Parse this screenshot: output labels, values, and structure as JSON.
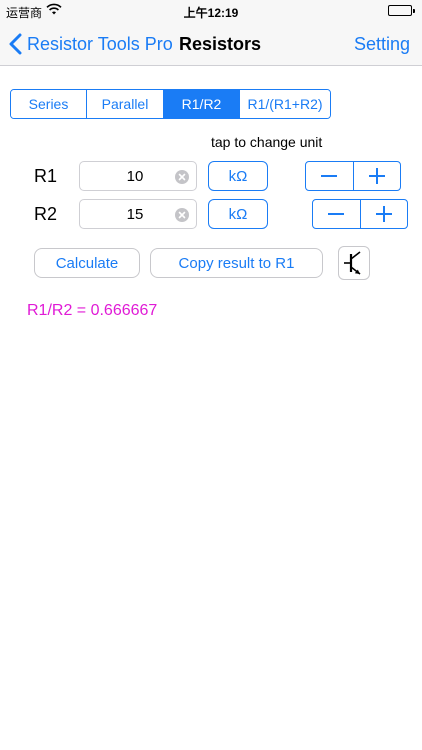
{
  "status_bar": {
    "carrier": "运营商",
    "time": "上午12:19"
  },
  "nav": {
    "back_label": "Resistor Tools Pro",
    "title": "Resistors",
    "setting_label": "Setting"
  },
  "segments": [
    {
      "label": "Series",
      "active": false
    },
    {
      "label": "Parallel",
      "active": false
    },
    {
      "label": "R1/R2",
      "active": true
    },
    {
      "label": "R1/(R1+R2)",
      "active": false
    }
  ],
  "unit_hint": "tap to change unit",
  "rows": [
    {
      "label": "R1",
      "value": "10",
      "unit": "kΩ"
    },
    {
      "label": "R2",
      "value": "15",
      "unit": "kΩ"
    }
  ],
  "buttons": {
    "calculate": "Calculate",
    "copy_result": "Copy result to R1"
  },
  "result": "R1/R2 = 0.666667",
  "colors": {
    "accent": "#1a7cf5",
    "result": "#e01bd6"
  },
  "icons": {
    "back": "chevron-left-icon",
    "wifi": "wifi-icon",
    "battery": "battery-icon",
    "clear": "clear-circle-icon",
    "minus": "minus-icon",
    "plus": "plus-icon",
    "transistor": "transistor-icon"
  }
}
